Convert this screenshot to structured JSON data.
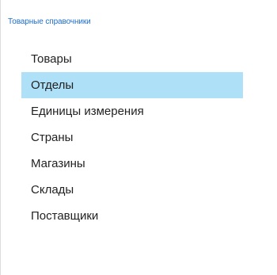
{
  "section": {
    "title": "Товарные справочники"
  },
  "menu": {
    "items": [
      {
        "label": "Товары",
        "selected": false
      },
      {
        "label": "Отделы",
        "selected": true
      },
      {
        "label": "Единицы измерения",
        "selected": false
      },
      {
        "label": "Страны",
        "selected": false
      },
      {
        "label": "Магазины",
        "selected": false
      },
      {
        "label": "Склады",
        "selected": false
      },
      {
        "label": "Поставщики",
        "selected": false
      }
    ]
  },
  "colors": {
    "section_title": "#1f6fc5",
    "selected_background": "#aee0f7",
    "item_text": "#222222"
  }
}
